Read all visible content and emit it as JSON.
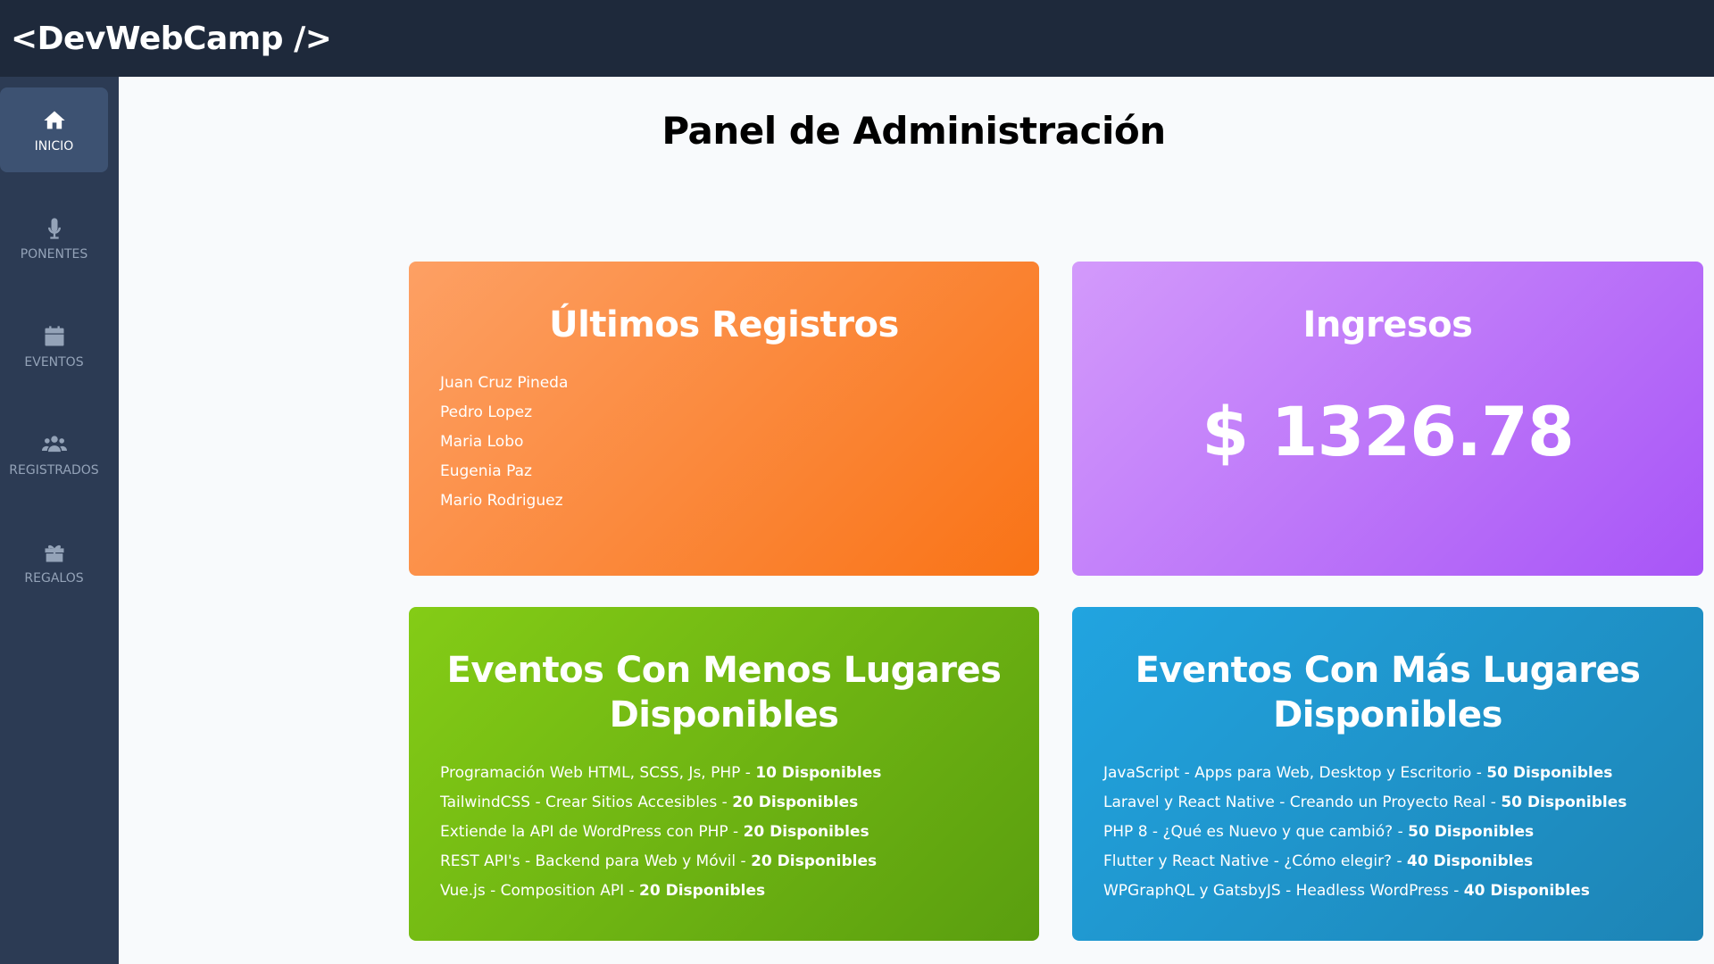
{
  "header": {
    "logo": "<DevWebCamp />"
  },
  "sidebar": {
    "items": [
      {
        "label": "Inicio",
        "icon": "home-icon",
        "active": true
      },
      {
        "label": "Ponentes",
        "icon": "microphone-icon",
        "active": false
      },
      {
        "label": "Eventos",
        "icon": "calendar-icon",
        "active": false
      },
      {
        "label": "Registrados",
        "icon": "users-icon",
        "active": false
      },
      {
        "label": "Regalos",
        "icon": "gift-icon",
        "active": false
      }
    ]
  },
  "main": {
    "title": "Panel de Administración",
    "registros": {
      "title": "Últimos Registros",
      "items": [
        "Juan Cruz Pineda",
        "Pedro Lopez",
        "Maria Lobo",
        "Eugenia Paz",
        "Mario Rodriguez"
      ]
    },
    "ingresos": {
      "title": "Ingresos",
      "amount": "$ 1326.78"
    },
    "menos": {
      "title": "Eventos Con Menos Lugares Disponibles",
      "items": [
        {
          "name": "Programación Web HTML, SCSS, Js, PHP - ",
          "avail": "10 Disponibles"
        },
        {
          "name": "TailwindCSS - Crear Sitios Accesibles - ",
          "avail": "20 Disponibles"
        },
        {
          "name": "Extiende la API de WordPress con PHP - ",
          "avail": "20 Disponibles"
        },
        {
          "name": "REST API's - Backend para Web y Móvil - ",
          "avail": "20 Disponibles"
        },
        {
          "name": "Vue.js - Composition API - ",
          "avail": "20 Disponibles"
        }
      ]
    },
    "mas": {
      "title": "Eventos Con Más Lugares Disponibles",
      "items": [
        {
          "name": "JavaScript - Apps para Web, Desktop y Escritorio - ",
          "avail": "50 Disponibles"
        },
        {
          "name": "Laravel y React Native - Creando un Proyecto Real - ",
          "avail": "50 Disponibles"
        },
        {
          "name": "PHP 8 - ¿Qué es Nuevo y que cambió? - ",
          "avail": "50 Disponibles"
        },
        {
          "name": "Flutter y React Native - ¿Cómo elegir? - ",
          "avail": "40 Disponibles"
        },
        {
          "name": "WPGraphQL y GatsbyJS - Headless WordPress - ",
          "avail": "40 Disponibles"
        }
      ]
    }
  },
  "colors": {
    "topbar": "#1e293b",
    "sidebar": "#2c3b54",
    "orange": "#f97316",
    "purple": "#a855f7",
    "green": "#84cc16",
    "blue": "#1d84b5"
  }
}
